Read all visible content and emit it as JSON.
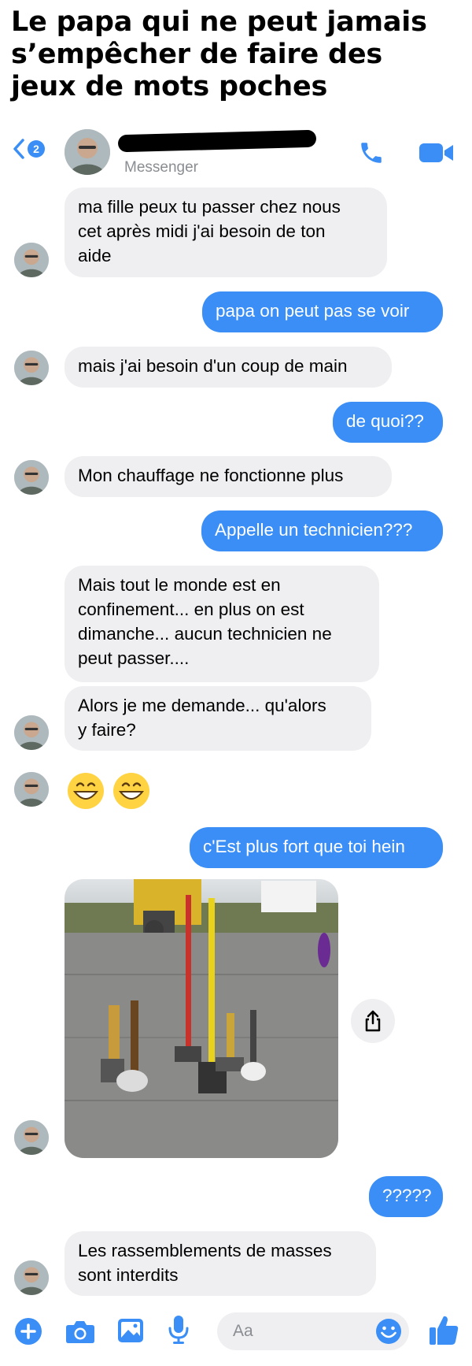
{
  "caption": "Le papa qui ne peut jamais\ns’empêcher de faire des\njeux de mots poches",
  "header": {
    "back_badge": "2",
    "subtitle": "Messenger"
  },
  "messages": [
    {
      "from": "dad",
      "text": "ma fille peux tu passer chez nous\ncet après midi j'ai besoin de ton\naide"
    },
    {
      "from": "me",
      "text": "papa on peut pas se voir"
    },
    {
      "from": "dad",
      "text": "mais j'ai besoin d'un coup de main"
    },
    {
      "from": "me",
      "text": "de quoi??"
    },
    {
      "from": "dad",
      "text": "Mon chauffage ne fonctionne plus"
    },
    {
      "from": "me",
      "text": "Appelle un technicien???"
    },
    {
      "from": "dad",
      "text": "Mais tout le monde est en\nconfinement... en plus on est\ndimanche... aucun technicien ne\npeut passer...."
    },
    {
      "from": "dad",
      "text": "Alors je me demande... qu'alors\ny faire?"
    },
    {
      "from": "dad",
      "text": "😁 😁"
    },
    {
      "from": "me",
      "text": "c'Est plus fort que toi hein"
    },
    {
      "from": "dad",
      "text": "[photo: sledgehammers standing upright on gravel]"
    },
    {
      "from": "me",
      "text": "?????"
    },
    {
      "from": "dad",
      "text": "Les rassemblements de masses\nsont interdits"
    }
  ],
  "composer": {
    "placeholder": "Aa"
  },
  "colors": {
    "accent": "#3a8ef6",
    "incoming_bubble": "#efeff1",
    "emoji_yellow": "#ffd342"
  },
  "icons": [
    "back-chevron-icon",
    "phone-icon",
    "video-camera-icon",
    "share-icon",
    "plus-icon",
    "camera-icon",
    "gallery-icon",
    "microphone-icon",
    "emoji-icon",
    "thumbs-up-icon"
  ]
}
